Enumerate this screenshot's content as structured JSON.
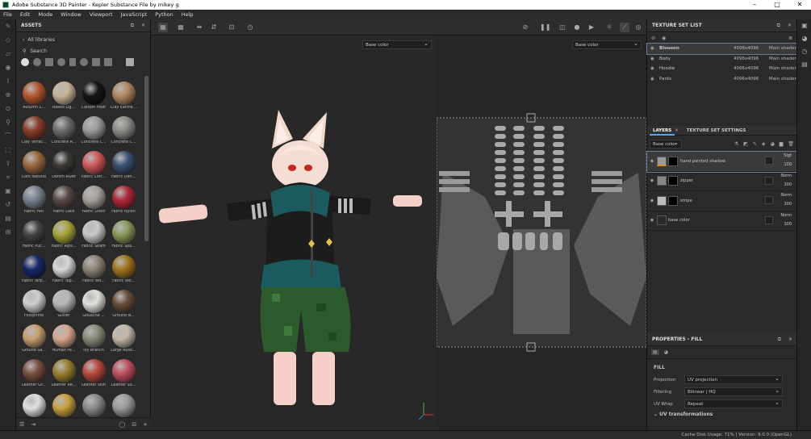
{
  "window": {
    "title": "Adobe Substance 3D Painter - Kepler Substance File by mikey g"
  },
  "menu": [
    "File",
    "Edit",
    "Mode",
    "Window",
    "Viewport",
    "JavaScript",
    "Python",
    "Help"
  ],
  "assets": {
    "header": "ASSETS",
    "libraries_label": "All libraries",
    "search_placeholder": "Search",
    "materials": [
      {
        "name": "Autumn L...",
        "color": "#b5582e"
      },
      {
        "name": "Baked Lig...",
        "color": "#c9b49a"
      },
      {
        "name": "Carbon Fiber",
        "color": "#151515"
      },
      {
        "name": "Clay Earthe...",
        "color": "#b28862"
      },
      {
        "name": "Clay Terrac...",
        "color": "#8a3f2c"
      },
      {
        "name": "Concrete A...",
        "color": "#6c6c6e"
      },
      {
        "name": "Concrete C...",
        "color": "#9a9a98"
      },
      {
        "name": "Concrete C...",
        "color": "#8c8d86"
      },
      {
        "name": "Cork Natural",
        "color": "#9a6a40"
      },
      {
        "name": "Denim Rivet",
        "color": "#3d3a36"
      },
      {
        "name": "Fabric Cott...",
        "color": "#d05a5a"
      },
      {
        "name": "Fabric Den...",
        "color": "#3e5274"
      },
      {
        "name": "Fabric Felt",
        "color": "#7a8290"
      },
      {
        "name": "Fabric Lace",
        "color": "#5a4a46"
      },
      {
        "name": "Fabric Linen",
        "color": "#a6a09a"
      },
      {
        "name": "Fabric Nylon",
        "color": "#b02a3a"
      },
      {
        "name": "Fabric Puc...",
        "color": "#444444"
      },
      {
        "name": "Fabric Rips...",
        "color": "#a6a43a"
      },
      {
        "name": "Fabric Seam",
        "color": "#c8c8c8"
      },
      {
        "name": "Fabric Spa...",
        "color": "#8a9a5a"
      },
      {
        "name": "Fabric Tarp...",
        "color": "#1a2a6a"
      },
      {
        "name": "Fabric Top...",
        "color": "#d8d8d8"
      },
      {
        "name": "Fabric Wo...",
        "color": "#8e8478"
      },
      {
        "name": "Fabric Wo...",
        "color": "#a0761e"
      },
      {
        "name": "Footprints",
        "color": "#cfcfcf"
      },
      {
        "name": "Glitter",
        "color": "#b8b8b8"
      },
      {
        "name": "Gouache ...",
        "color": "#e0e0dc"
      },
      {
        "name": "Ground N...",
        "color": "#6a4e3a"
      },
      {
        "name": "Ground Sa...",
        "color": "#c9a070"
      },
      {
        "name": "Human Fe...",
        "color": "#d8a890"
      },
      {
        "name": "Ivy Branch",
        "color": "#8a8a7a"
      },
      {
        "name": "Large Rusti...",
        "color": "#c4b8a8"
      },
      {
        "name": "Leather Gr...",
        "color": "#7a5040"
      },
      {
        "name": "Leather Re...",
        "color": "#9a8030"
      },
      {
        "name": "Leather Skin",
        "color": "#b84a3a"
      },
      {
        "name": "Leather Su...",
        "color": "#c05060"
      },
      {
        "name": "Marble Vei...",
        "color": "#e0e0e0"
      },
      {
        "name": "Medium A...",
        "color": "#c9a040"
      },
      {
        "name": "Metal Brus...",
        "color": "#8a8a8a"
      },
      {
        "name": "Metal Foil",
        "color": "#9a9a9a"
      }
    ]
  },
  "viewport": {
    "channel_3d": "Base color",
    "channel_2d": "Base color"
  },
  "texture_set_list": {
    "header": "TEXTURE SET LIST",
    "rows": [
      {
        "name": "Blouson",
        "resolution": "4096x4096",
        "shader": "Main shader"
      },
      {
        "name": "Body",
        "resolution": "4096x4096",
        "shader": "Main shader"
      },
      {
        "name": "Hoodie",
        "resolution": "4096x4096",
        "shader": "Main shader"
      },
      {
        "name": "Pants",
        "resolution": "4096x4096",
        "shader": "Main shader"
      }
    ]
  },
  "layers_panel": {
    "tab_layers": "LAYERS",
    "tab_texture_set_settings": "TEXTURE SET SETTINGS",
    "channel": "Base color",
    "layers": [
      {
        "name": "hand painted shadow",
        "blend": "Slgt",
        "opacity": "100"
      },
      {
        "name": "zipper",
        "blend": "Norm",
        "opacity": "100"
      },
      {
        "name": "stripe",
        "blend": "Norm",
        "opacity": "100"
      },
      {
        "name": "base color",
        "blend": "Norm",
        "opacity": "100"
      }
    ]
  },
  "properties": {
    "header": "PROPERTIES - FILL",
    "section": "FILL",
    "rows": [
      {
        "label": "Projection",
        "value": "UV projection"
      },
      {
        "label": "Filtering",
        "value": "Bilinear | HQ"
      },
      {
        "label": "UV Wrap",
        "value": "Repeat"
      }
    ],
    "subsection": "UV transformations"
  },
  "status": {
    "text": "Cache Disk Usage:   71% | Version: 9.0.0 (OpenGL)"
  }
}
